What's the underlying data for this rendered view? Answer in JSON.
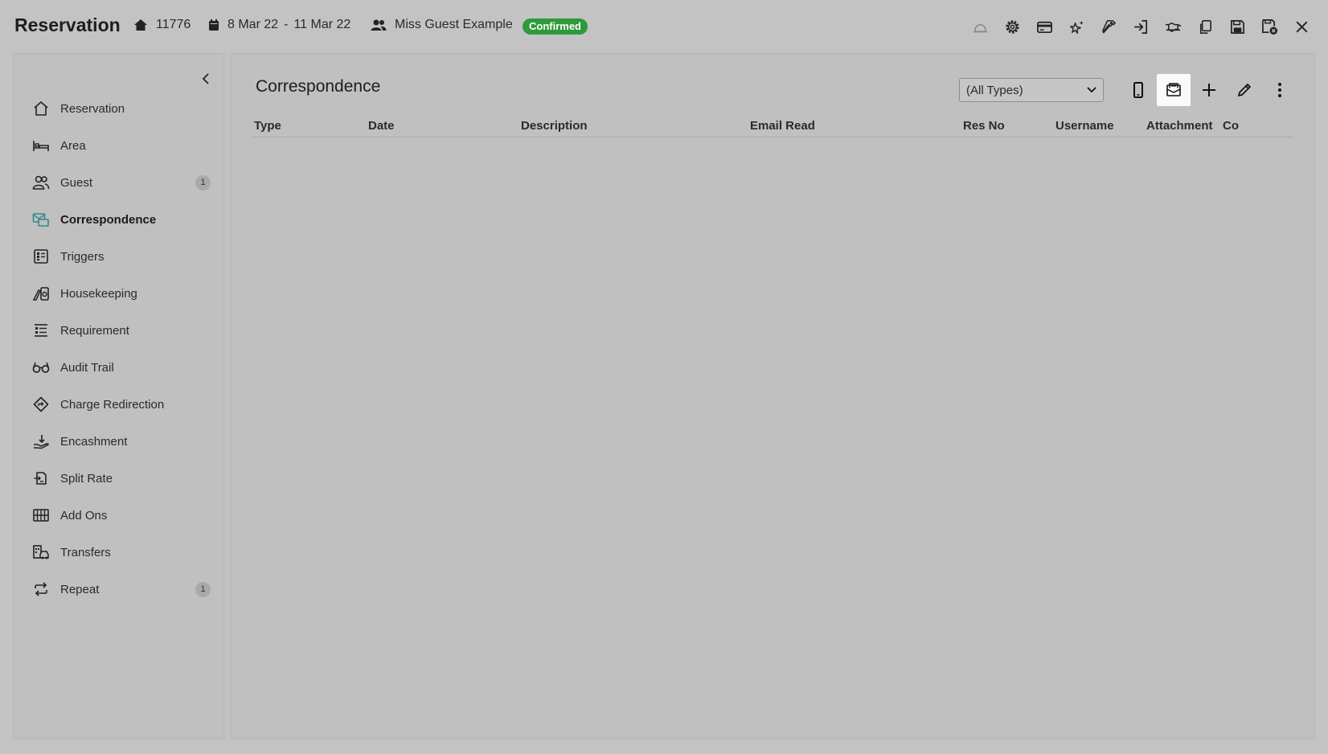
{
  "header": {
    "title": "Reservation",
    "reservation_no": "11776",
    "arrival": "8 Mar 22",
    "date_separator": "-",
    "departure": "11 Mar 22",
    "guest_name": "Miss Guest Example",
    "status": "Confirmed",
    "status_color": "#2e9a3b",
    "actions": [
      "bell-icon",
      "gear-icon",
      "credit-card-icon",
      "sparkle-star-icon",
      "hammer-icon",
      "sign-in-icon",
      "handshake-icon",
      "copy-icon",
      "save-icon",
      "save-close-icon",
      "close-icon"
    ]
  },
  "sidebar": {
    "items": [
      {
        "label": "Reservation",
        "icon": "house-icon"
      },
      {
        "label": "Area",
        "icon": "bed-icon"
      },
      {
        "label": "Guest",
        "icon": "users-icon",
        "count": "1"
      },
      {
        "label": "Correspondence",
        "icon": "correspondence-icon",
        "active": true
      },
      {
        "label": "Triggers",
        "icon": "triggers-icon"
      },
      {
        "label": "Housekeeping",
        "icon": "housekeeping-icon"
      },
      {
        "label": "Requirement",
        "icon": "requirement-icon"
      },
      {
        "label": "Audit Trail",
        "icon": "glasses-icon"
      },
      {
        "label": "Charge Redirection",
        "icon": "redirect-icon"
      },
      {
        "label": "Encashment",
        "icon": "encashment-icon"
      },
      {
        "label": "Split Rate",
        "icon": "split-rate-icon"
      },
      {
        "label": "Add Ons",
        "icon": "add-ons-icon"
      },
      {
        "label": "Transfers",
        "icon": "transfers-icon"
      },
      {
        "label": "Repeat",
        "icon": "repeat-icon",
        "count": "1"
      }
    ]
  },
  "main": {
    "title": "Correspondence",
    "type_filter": {
      "selected": "(All Types)"
    },
    "actions": [
      "mobile-icon",
      "email-icon",
      "plus-icon",
      "pencil-icon",
      "more-vertical-icon"
    ],
    "columns": [
      "Type",
      "Date",
      "Description",
      "Email Read",
      "Res No",
      "Username",
      "Attachment",
      "Co"
    ]
  },
  "colors": {
    "background": "#c3c3c3",
    "panel": "#c0c0c0",
    "accent": "#2e8a8a"
  }
}
